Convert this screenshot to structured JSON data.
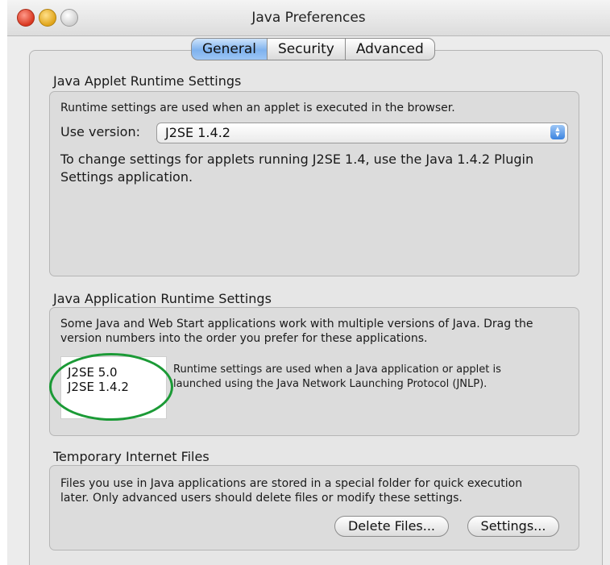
{
  "window": {
    "title": "Java Preferences"
  },
  "tabs": [
    {
      "label": "General",
      "active": true
    },
    {
      "label": "Security",
      "active": false
    },
    {
      "label": "Advanced",
      "active": false
    }
  ],
  "applet": {
    "title": "Java Applet Runtime Settings",
    "description": "Runtime settings are used when an applet is executed in the browser.",
    "version_label": "Use version:",
    "version_value": "J2SE 1.4.2",
    "note_line1": "To change settings for applets running J2SE 1.4, use the Java 1.4.2 Plugin",
    "note_line2": "Settings application."
  },
  "application": {
    "title": "Java Application Runtime Settings",
    "description_line1": "Some Java and Web Start applications work with multiple versions of Java. Drag the",
    "description_line2": "version numbers into the order you prefer for these applications.",
    "versions": [
      "J2SE 5.0",
      "J2SE 1.4.2"
    ],
    "info_line1": "Runtime settings are used when a Java application or applet is",
    "info_line2": "launched using the Java Network Launching Protocol (JNLP)."
  },
  "temp_files": {
    "title": "Temporary Internet Files",
    "description_line1": "Files you use in Java applications are stored in a special folder for quick execution",
    "description_line2": "later.  Only advanced users should delete files or modify these settings.",
    "delete_label": "Delete Files...",
    "settings_label": "Settings..."
  },
  "colors": {
    "highlight_ellipse": "#1b9a36",
    "active_tab": "#7fb2ee"
  }
}
